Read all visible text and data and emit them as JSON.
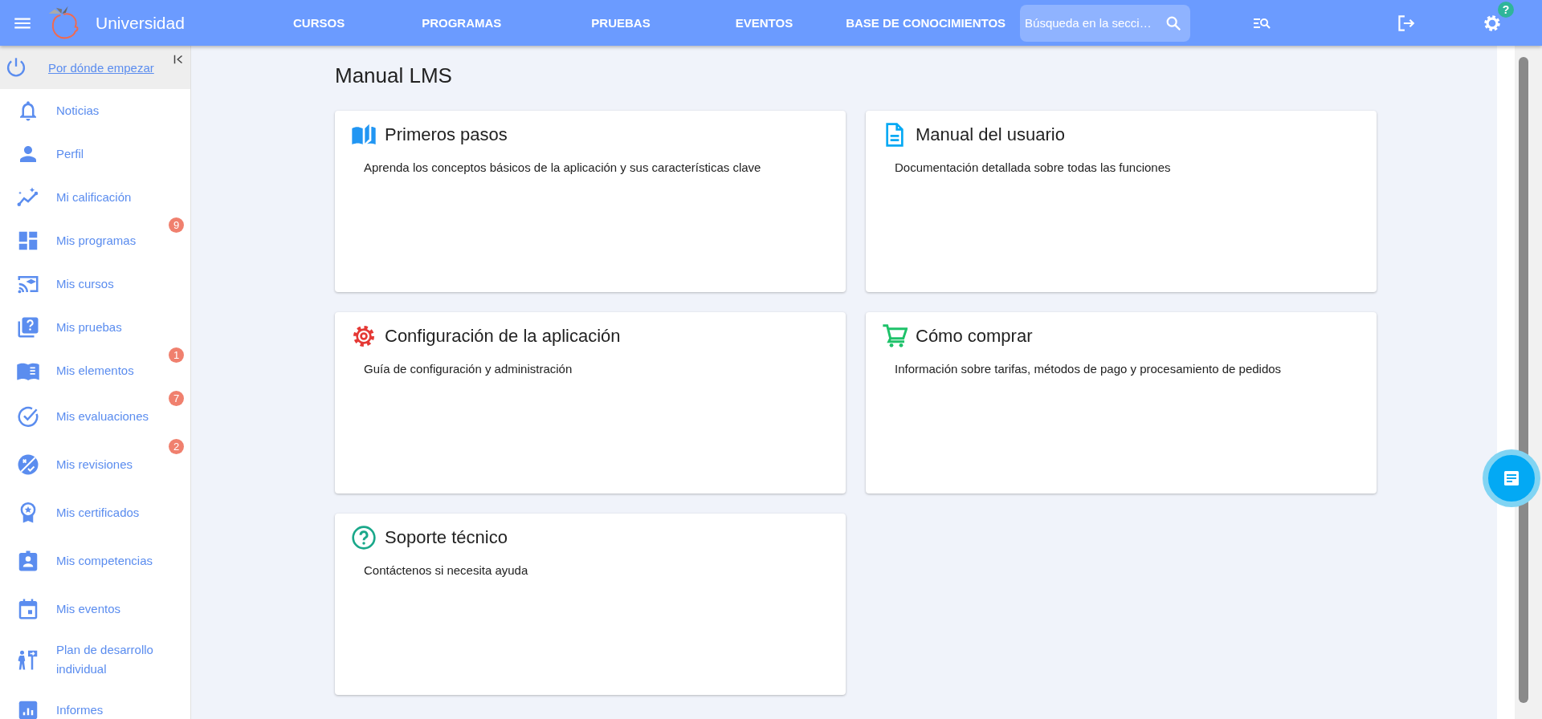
{
  "header": {
    "title": "Universidad",
    "nav": [
      {
        "label": "CURSOS"
      },
      {
        "label": "PROGRAMAS"
      },
      {
        "label": "PRUEBAS"
      },
      {
        "label": "EVENTOS"
      },
      {
        "label": "BASE DE CONOCIMIENTOS"
      }
    ],
    "search": {
      "placeholder": "Búsqueda en la secci…"
    },
    "help_badge": "?"
  },
  "sidebar": {
    "start_link": "Por dónde empezar",
    "items": [
      {
        "kind": "bell",
        "label": "Noticias"
      },
      {
        "kind": "person",
        "label": "Perfil"
      },
      {
        "kind": "trend",
        "label": "Mi calificación"
      },
      {
        "kind": "dashboard",
        "label": "Mis programas",
        "badge": "9"
      },
      {
        "kind": "cast",
        "label": "Mis cursos"
      },
      {
        "kind": "quiz",
        "label": "Mis pruebas"
      },
      {
        "kind": "book",
        "label": "Mis elementos",
        "badge": "1"
      },
      {
        "kind": "check",
        "label": "Mis evaluaciones",
        "badge": "7"
      },
      {
        "kind": "review",
        "label": "Mis revisiones",
        "badge": "2"
      },
      {
        "kind": "award",
        "label": "Mis certificados"
      },
      {
        "kind": "idbadge",
        "label": "Mis competencias"
      },
      {
        "kind": "calendar",
        "label": "Mis eventos"
      },
      {
        "kind": "plan",
        "label": "Plan de desarrollo individual"
      },
      {
        "kind": "chart",
        "label": "Informes"
      }
    ]
  },
  "main": {
    "title": "Manual LMS",
    "cards": [
      {
        "kind": "book",
        "color": "#2196f3",
        "title": "Primeros pasos",
        "description": "Aprenda los conceptos básicos de la aplicación y sus características clave"
      },
      {
        "kind": "document",
        "color": "#03a9f4",
        "title": "Manual del usuario",
        "description": "Documentación detallada sobre todas las funciones"
      },
      {
        "kind": "gear",
        "color": "#e53935",
        "title": "Configuración de la aplicación",
        "description": "Guía de configuración y administración"
      },
      {
        "kind": "cart",
        "color": "#1ec26a",
        "title": "Cómo comprar",
        "description": "Información sobre tarifas, métodos de pago y procesamiento de pedidos"
      },
      {
        "kind": "help",
        "color": "#1aa88a",
        "title": "Soporte técnico",
        "description": "Contáctenos si necesita ayuda"
      }
    ]
  }
}
